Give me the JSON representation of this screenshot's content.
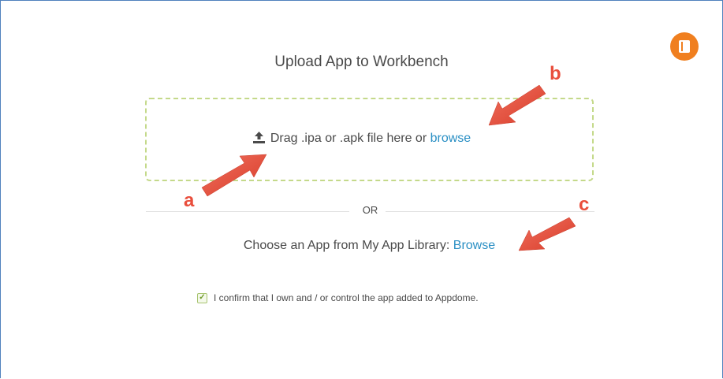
{
  "header": {
    "title": "Upload App to Workbench",
    "help_icon": "book-icon",
    "accent_color": "#f07f1f"
  },
  "dropzone": {
    "icon": "upload-icon",
    "text": "Drag .ipa or .apk file here or ",
    "browse_link": "browse"
  },
  "divider": {
    "label": "OR"
  },
  "library": {
    "text": "Choose an App from My App Library: ",
    "browse_link": "Browse"
  },
  "confirm": {
    "checked": true,
    "text": "I confirm that I own and / or control the app added to Appdome."
  },
  "annotations": {
    "a": "a",
    "b": "b",
    "c": "c",
    "arrow_color": "#e94e3c"
  }
}
